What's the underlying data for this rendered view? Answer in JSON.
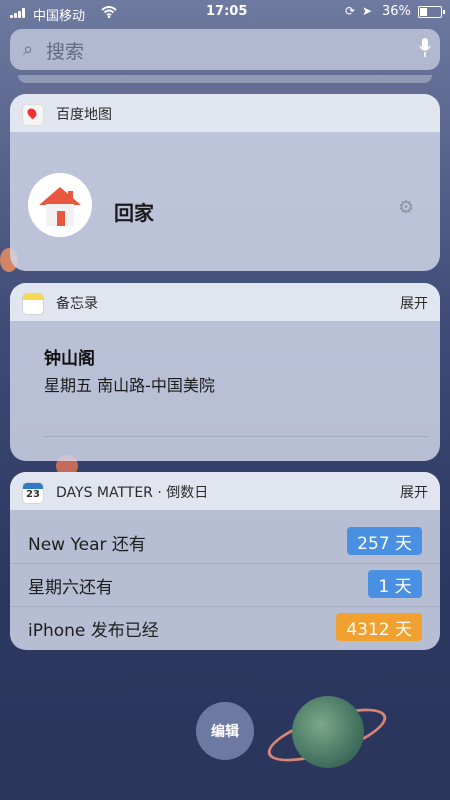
{
  "status_bar": {
    "carrier": "中国移动",
    "time": "17:05",
    "battery_percent": "36%",
    "battery_level": 0.36
  },
  "search": {
    "placeholder": "搜索"
  },
  "baidu_widget": {
    "app_name": "百度地图",
    "shortcut_label": "回家"
  },
  "notes_widget": {
    "app_name": "备忘录",
    "expand_label": "展开",
    "title": "钟山阁",
    "subtitle": "星期五  南山路-中国美院"
  },
  "days_widget": {
    "app_name": "DAYS MATTER · 倒数日",
    "icon_day": "23",
    "expand_label": "展开",
    "rows": [
      {
        "label": "New Year 还有",
        "value": "257 天",
        "color": "#4a90e2"
      },
      {
        "label": "星期六还有",
        "value": "1 天",
        "color": "#4a90e2"
      },
      {
        "label": "iPhone 发布已经",
        "value": "4312 天",
        "color": "#f0a12f"
      }
    ]
  },
  "edit_button": {
    "label": "编辑"
  }
}
